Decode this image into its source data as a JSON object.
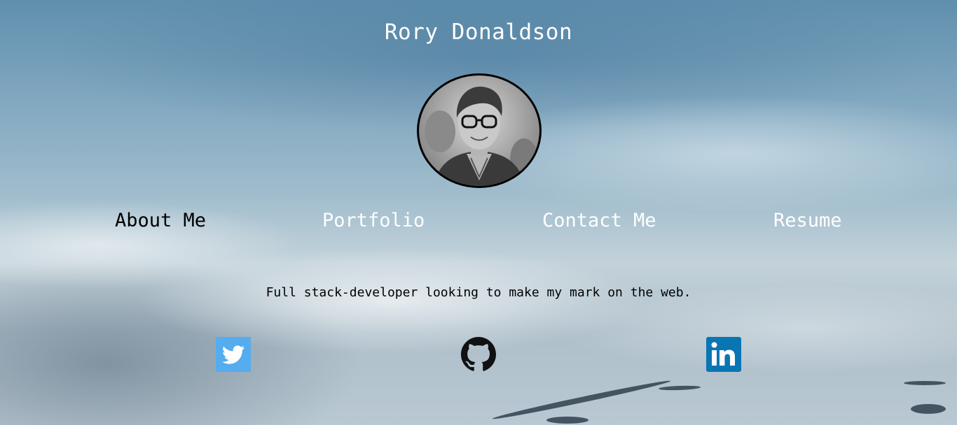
{
  "header": {
    "title": "Rory Donaldson"
  },
  "nav": {
    "items": [
      {
        "label": "About Me",
        "active": true
      },
      {
        "label": "Portfolio",
        "active": false
      },
      {
        "label": "Contact Me",
        "active": false
      },
      {
        "label": "Resume",
        "active": false
      }
    ]
  },
  "main": {
    "tagline": "Full stack-developer looking to make my mark on the web."
  },
  "social": {
    "icons": [
      "twitter-icon",
      "github-icon",
      "linkedin-icon"
    ]
  },
  "colors": {
    "twitter": "#55acee",
    "github": "#111111",
    "linkedin": "#0a75b3",
    "nav_active": "#000000",
    "nav_inactive": "#ffffff"
  }
}
